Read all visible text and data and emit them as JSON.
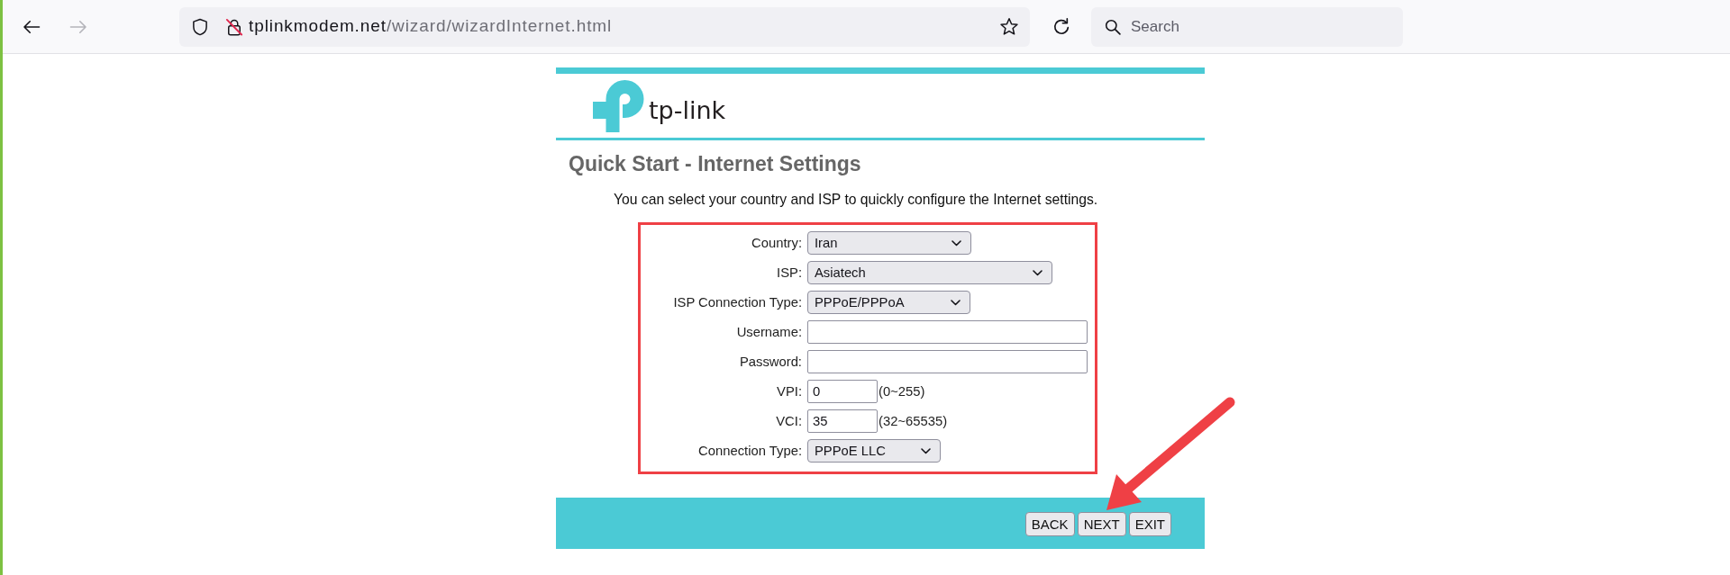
{
  "browser": {
    "nav": [
      {
        "kind": "back",
        "disabled": false
      },
      {
        "kind": "forward",
        "disabled": true
      }
    ],
    "address": {
      "host": "tplinkmodem.net",
      "path": "/wizard/wizardInternet.html"
    },
    "search": {
      "placeholder": "Search"
    }
  },
  "page": {
    "logo": "tp-link",
    "title": "Quick Start - Internet Settings",
    "intro": "You can select your country and ISP to quickly configure the Internet settings.",
    "fields": [
      {
        "kind": "select",
        "label": "Country:",
        "value": "Iran"
      },
      {
        "kind": "select",
        "label": "ISP:",
        "value": "Asiatech"
      },
      {
        "kind": "select",
        "label": "ISP Connection Type:",
        "value": "PPPoE/PPPoA"
      },
      {
        "kind": "text",
        "label": "Username:"
      },
      {
        "kind": "password",
        "label": "Password:"
      },
      {
        "kind": "text",
        "label": "VPI:",
        "value": "0",
        "hint": "(0~255)"
      },
      {
        "kind": "text",
        "label": "VCI:",
        "value": "35",
        "hint": "(32~65535)"
      },
      {
        "kind": "select",
        "label": "Connection Type:",
        "value": "PPPoE LLC"
      }
    ],
    "buttons": [
      "BACK",
      "NEXT",
      "EXIT"
    ]
  }
}
